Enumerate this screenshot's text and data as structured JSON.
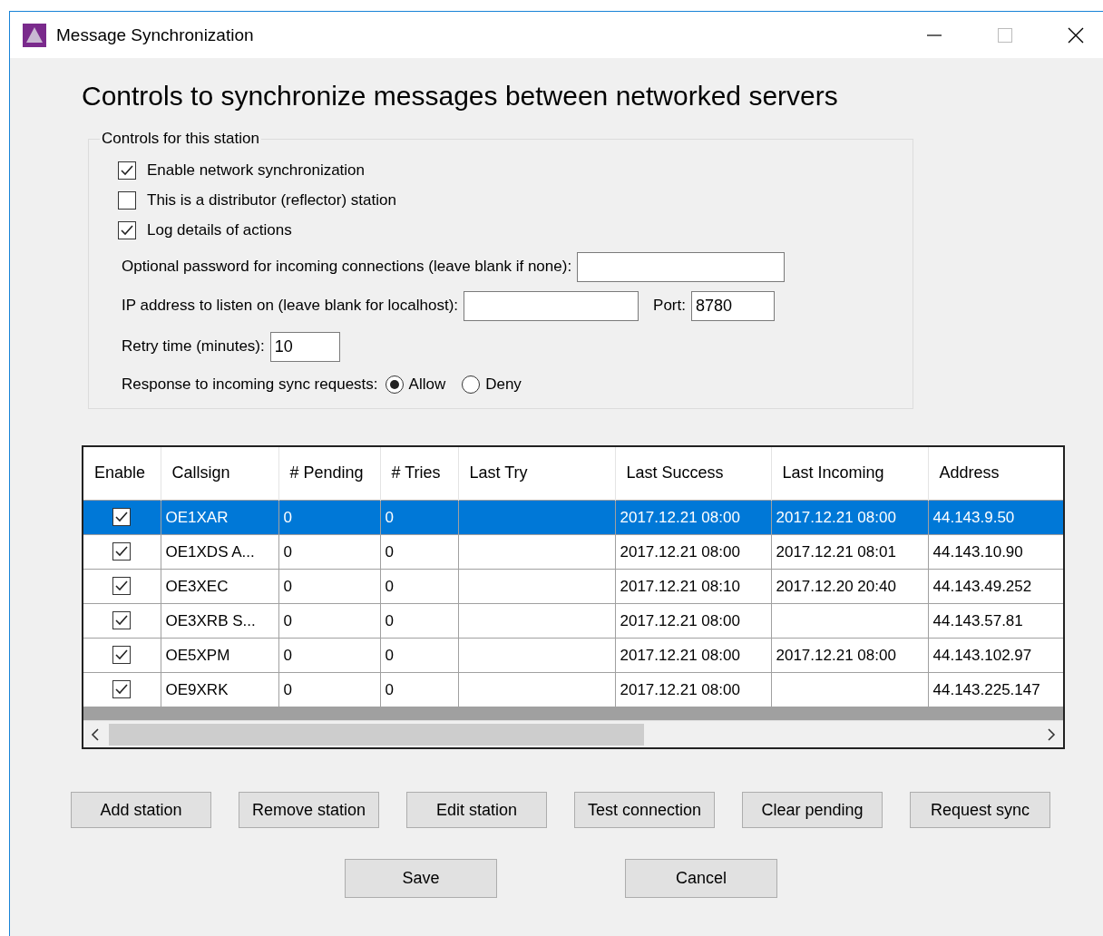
{
  "window": {
    "title": "Message Synchronization"
  },
  "heading": "Controls to synchronize messages between networked servers",
  "station_group": {
    "legend": "Controls for this station",
    "options": [
      {
        "label": "Enable network synchronization",
        "checked": true
      },
      {
        "label": "This is a distributor (reflector) station",
        "checked": false
      },
      {
        "label": "Log details of actions",
        "checked": true
      }
    ],
    "password": {
      "label": "Optional password for incoming connections (leave blank if none):"
    },
    "ip_address": {
      "label": "IP address to listen on (leave blank for localhost):"
    },
    "port": {
      "label": "Port:",
      "value": "8780"
    },
    "retry": {
      "label": "Retry time (minutes):",
      "value": "10"
    },
    "response": {
      "label": "Response to incoming sync requests:",
      "choices": [
        {
          "label": "Allow",
          "selected": true
        },
        {
          "label": "Deny",
          "selected": false
        }
      ]
    }
  },
  "table": {
    "columns": [
      "Enable",
      "Callsign",
      "# Pending",
      "# Tries",
      "Last Try",
      "Last Success",
      "Last Incoming",
      "Address"
    ],
    "rows": [
      {
        "selected": true,
        "enabled": true,
        "callsign": "OE1XAR",
        "pending": "0",
        "tries": "0",
        "last_success": "2017.12.21 08:00",
        "last_incoming": "2017.12.21 08:00",
        "address": "44.143.9.50"
      },
      {
        "selected": false,
        "enabled": true,
        "callsign": "OE1XDS A...",
        "pending": "0",
        "tries": "0",
        "last_success": "2017.12.21 08:00",
        "last_incoming": "2017.12.21 08:01",
        "address": "44.143.10.90"
      },
      {
        "selected": false,
        "enabled": true,
        "callsign": "OE3XEC",
        "pending": "0",
        "tries": "0",
        "last_success": "2017.12.21 08:10",
        "last_incoming": "2017.12.20 20:40",
        "address": "44.143.49.252"
      },
      {
        "selected": false,
        "enabled": true,
        "callsign": "OE3XRB S...",
        "pending": "0",
        "tries": "0",
        "last_success": "2017.12.21 08:00",
        "address": "44.143.57.81"
      },
      {
        "selected": false,
        "enabled": true,
        "callsign": "OE5XPM",
        "pending": "0",
        "tries": "0",
        "last_success": "2017.12.21 08:00",
        "last_incoming": "2017.12.21 08:00",
        "address": "44.143.102.97"
      },
      {
        "selected": false,
        "enabled": true,
        "callsign": "OE9XRK",
        "pending": "0",
        "tries": "0",
        "last_success": "2017.12.21 08:00",
        "address": "44.143.225.147"
      }
    ]
  },
  "station_buttons": [
    "Add station",
    "Remove station",
    "Edit station",
    "Test connection",
    "Clear pending",
    "Request sync"
  ],
  "dialog_buttons": [
    "Save",
    "Cancel"
  ]
}
